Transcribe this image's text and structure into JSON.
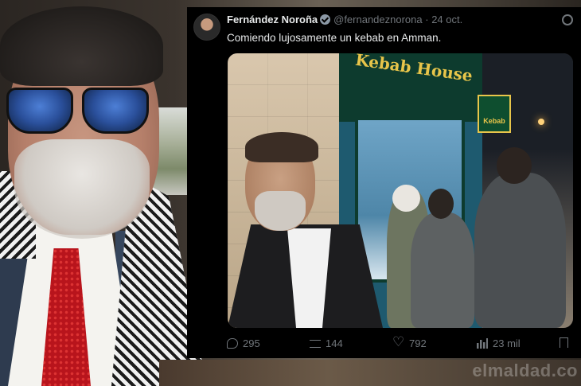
{
  "tweet": {
    "author_name": "Fernández Noroña",
    "handle": "@fernandeznorona",
    "date": "24 oct.",
    "text": "Comiendo lujosamente un kebab en Amman.",
    "media": {
      "sign_main": "Kebab House",
      "sign_side": "Kebab"
    },
    "actions": {
      "replies": "295",
      "reposts": "144",
      "likes": "792",
      "views": "23 mil"
    }
  },
  "watermark": "elmaldad.co",
  "icons": [
    "verified-icon",
    "repost-icon",
    "reply-icon",
    "retweet-icon",
    "like-icon",
    "views-icon",
    "bookmark-icon"
  ]
}
